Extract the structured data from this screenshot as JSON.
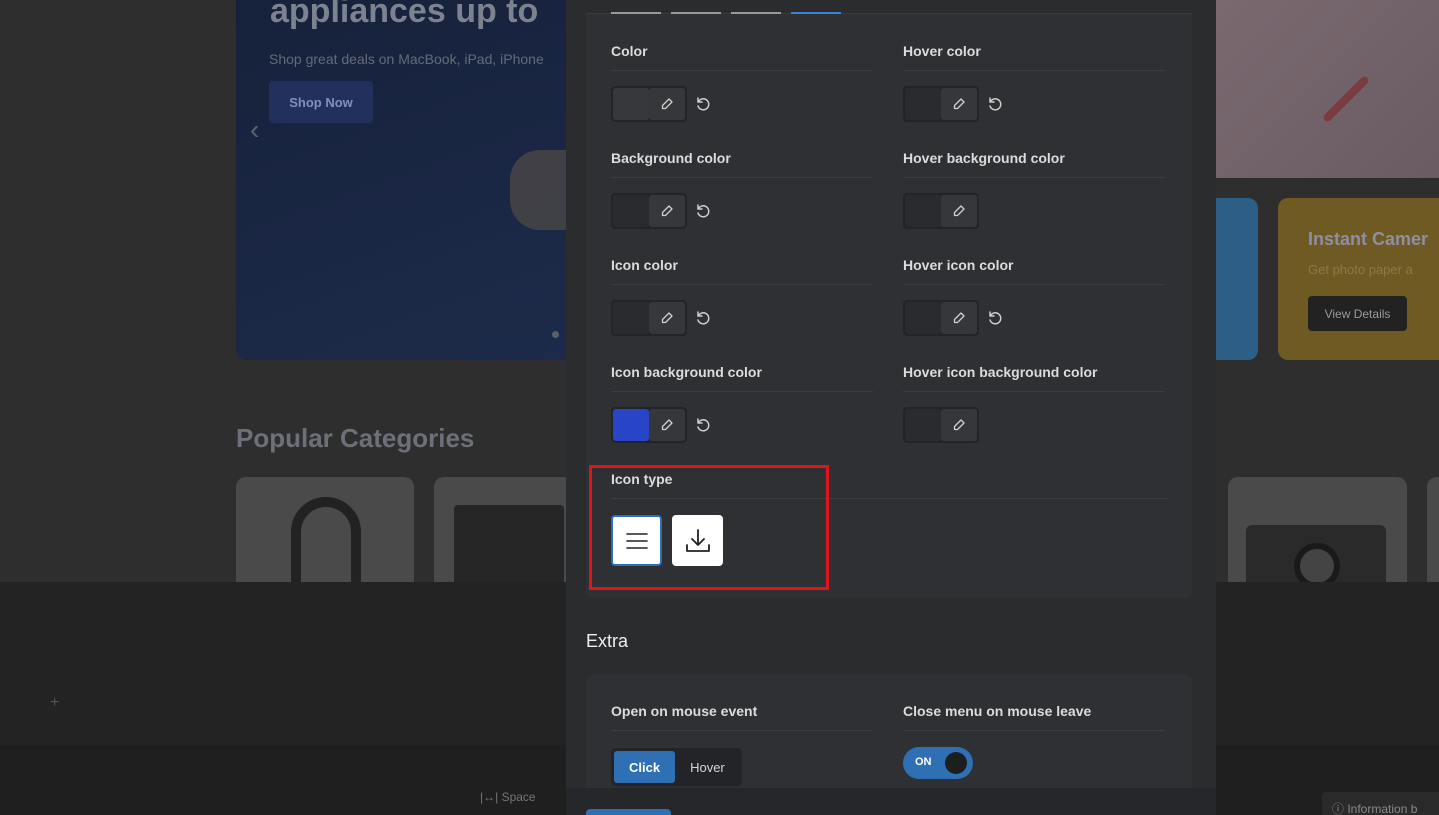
{
  "background_site": {
    "hero_title": "appliances up to",
    "hero_subtitle": "Shop great deals on MacBook, iPad, iPhone",
    "hero_button": "Shop Now",
    "promo_title": "Instant Camer",
    "promo_subtitle": "Get photo paper a",
    "promo_button": "View Details",
    "section_title": "Popular Categories",
    "space_tab": "Space",
    "info_tab": "Information b"
  },
  "panel": {
    "fields": {
      "color": "Color",
      "hover_color": "Hover color",
      "background_color": "Background color",
      "hover_background_color": "Hover background color",
      "icon_color": "Icon color",
      "hover_icon_color": "Hover icon color",
      "icon_background_color": "Icon background color",
      "hover_icon_background_color": "Hover icon background color",
      "icon_type": "Icon type"
    },
    "swatch_colors": {
      "default": "#2a2b2e",
      "icon_background": "#2845c8"
    },
    "icon_type_options": [
      {
        "icon": "hamburger-menu-icon",
        "selected": true
      },
      {
        "icon": "download-icon",
        "selected": false
      }
    ]
  },
  "extra": {
    "heading": "Extra",
    "open_on_mouse_event": "Open on mouse event",
    "mouse_event_options": [
      "Click",
      "Hover"
    ],
    "mouse_event_selected": "Click",
    "close_menu_on_mouse_leave": "Close menu on mouse leave",
    "toggle_label": "ON",
    "toggle_on": true
  },
  "colors": {
    "accent": "#2f6fb3",
    "highlight": "#e0141b"
  }
}
